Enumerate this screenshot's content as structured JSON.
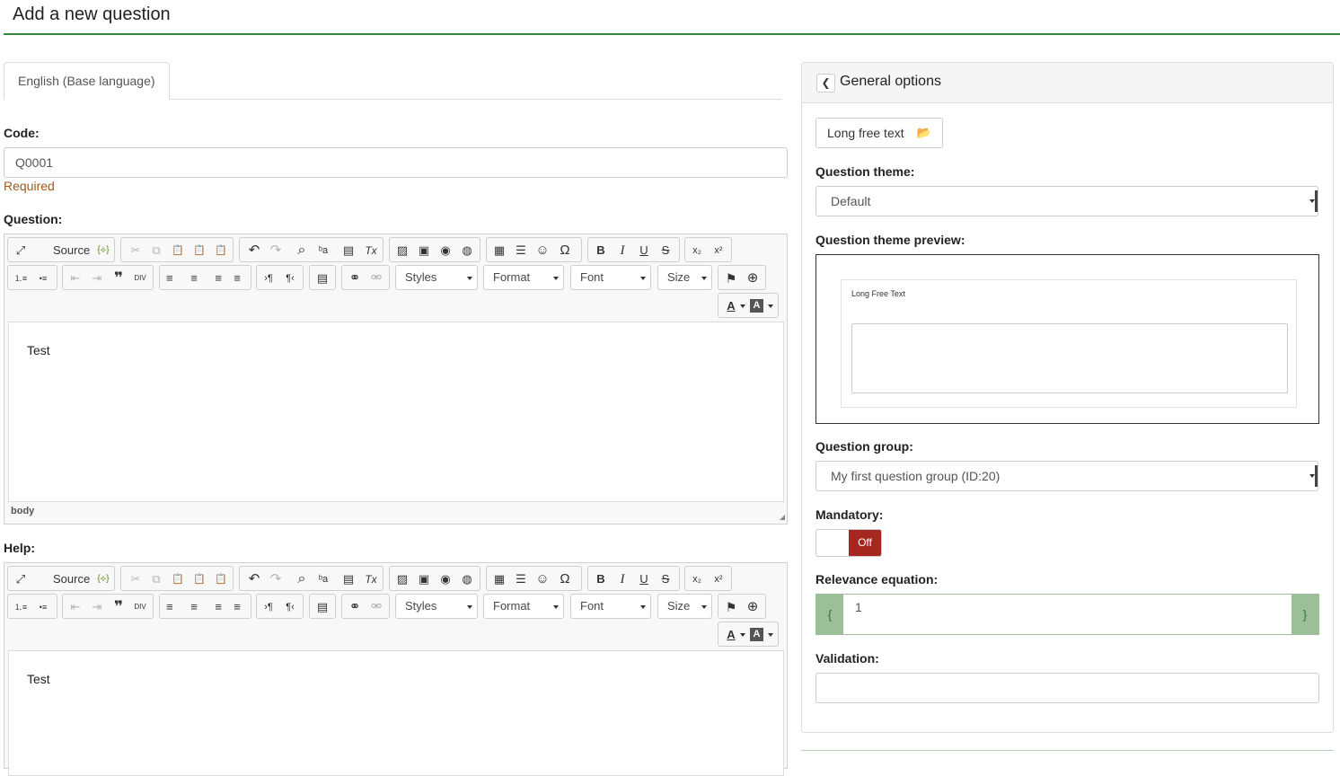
{
  "page": {
    "title": "Add a new question"
  },
  "tabs": [
    {
      "label": "English (Base language)",
      "active": true
    }
  ],
  "code": {
    "label": "Code:",
    "value": "Q0001",
    "hint": "Required"
  },
  "question": {
    "label": "Question:",
    "content": "Test",
    "path": "body"
  },
  "help": {
    "label": "Help:",
    "content": "Test"
  },
  "editor_toolbar": {
    "row1": [
      "maximize-icon",
      "source-label",
      "templates-icon",
      "cut-icon",
      "copy-icon",
      "paste-icon",
      "paste-text-icon",
      "paste-word-icon",
      "undo-icon",
      "redo-icon",
      "find-icon",
      "replace-icon",
      "select-all-icon",
      "remove-format-icon",
      "image-icon",
      "flash-icon",
      "media-icon",
      "iframe-icon",
      "table-icon",
      "horizontal-rule-icon",
      "smiley-icon",
      "special-char-icon",
      "bold-icon",
      "italic-icon",
      "underline-icon",
      "strike-icon",
      "subscript-icon",
      "superscript-icon"
    ],
    "source": "Source",
    "styles": "Styles",
    "format": "Format",
    "font": "Font",
    "size": "Size",
    "glyphs": {
      "maximize": "⤢",
      "templates": "{⟡}",
      "cut": "✂",
      "copy": "⧉",
      "paste": "📋",
      "undo": "↶",
      "redo": "↷",
      "find": "⌕",
      "replace": "ᵇa",
      "select": "▤",
      "clear": "Tx",
      "image": "▨",
      "flash": "▣",
      "media": "◉",
      "iframe": "◍",
      "table": "▦",
      "hr": "☰",
      "smiley": "☺",
      "omega": "Ω",
      "bold": "B",
      "italic": "I",
      "underline": "U",
      "strike": "S",
      "sub": "x₂",
      "sup": "x²",
      "ol": "⒈≡",
      "ul": "•≡",
      "outdent": "⇤",
      "indent": "⇥",
      "quote": "❞",
      "div": "DIV",
      "align_left": "≡",
      "align_center": "≡",
      "align_right": "≡",
      "justify": "≡",
      "ltr": "›¶",
      "rtl": "¶‹",
      "lang": "▤",
      "link": "⚭",
      "unlink": "⚮",
      "anchor": "⚑",
      "globe": "⊕",
      "text_color": "A",
      "bg_color": "A"
    }
  },
  "general_options": {
    "title": "General options",
    "question_type": "Long free text",
    "question_theme": {
      "label": "Question theme:",
      "value": "Default"
    },
    "theme_preview": {
      "label": "Question theme preview:",
      "sample_label": "Long Free Text"
    },
    "question_group": {
      "label": "Question group:",
      "value": "My first question group (ID:20)"
    },
    "mandatory": {
      "label": "Mandatory:",
      "state": "Off"
    },
    "relevance": {
      "label": "Relevance equation:",
      "value": "1",
      "open_brace": "{",
      "close_brace": "}"
    },
    "validation": {
      "label": "Validation:",
      "value": ""
    }
  },
  "colors": {
    "accent": "#328637",
    "mandatory_off": "#a5271f",
    "relevance": "#9bbf98"
  }
}
